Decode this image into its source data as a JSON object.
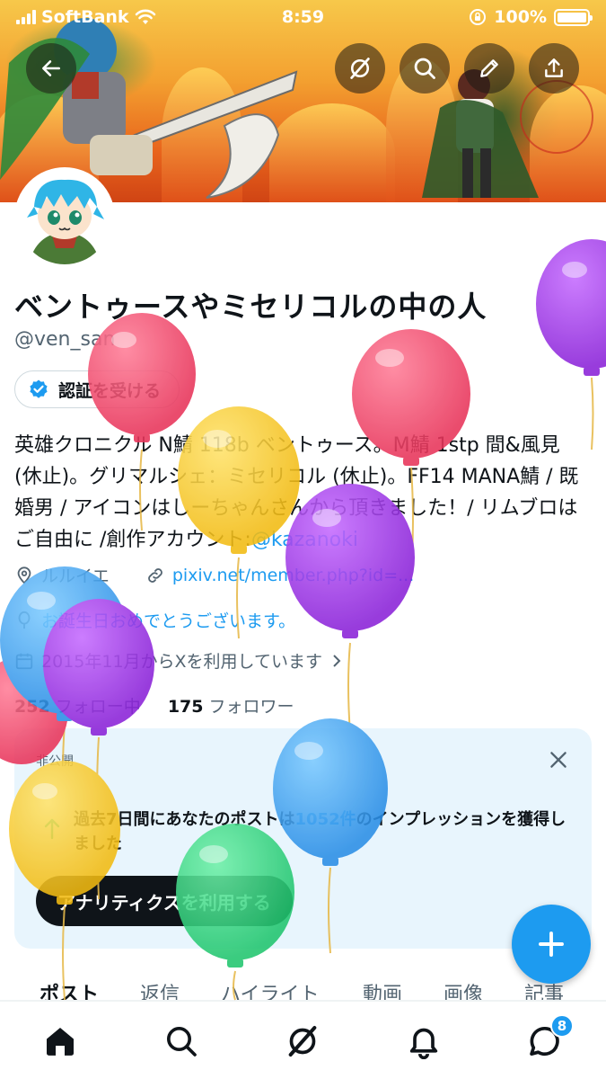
{
  "status_bar": {
    "carrier": "SoftBank",
    "time": "8:59",
    "battery": "100%"
  },
  "header": {
    "back_icon": "arrow-left-icon",
    "grok_icon": "grok-icon",
    "search_icon": "search-icon",
    "edit_icon": "pencil-icon",
    "share_icon": "share-icon"
  },
  "profile": {
    "display_name": "ベントゥースやミセリコルの中の人",
    "handle": "@ven_san",
    "verify_button": "認証を受ける",
    "bio_text": "英雄クロニクル N鯖 118b ベントゥース。M鯖 1stp 間&風見 (休止)。グリマルシェ：ミセリコル (休止)。FF14 MANA鯖 / 既婚男 / アイコンはしーちゃんさんから頂きました！/ リムブロはご自由に /創作アカウント:",
    "bio_link": "@kazanoki",
    "location": "ルルイエ",
    "website": "pixiv.net/member.php?id=...",
    "birthday": "お誕生日おめでとうございます。",
    "joined": "2015年11月からXを利用しています",
    "following_count": "252",
    "following_label": "フォロー中",
    "followers_count": "175",
    "followers_label": "フォロワー"
  },
  "analytics_card": {
    "private_label": "非公開",
    "message_before": "過去7日間にあなたのポストは",
    "message_number": "1052件",
    "message_after": "のインプレッションを獲得しました",
    "cta": "アナリティクスを利用する"
  },
  "tabs": [
    "ポスト",
    "返信",
    "ハイライト",
    "動画",
    "画像",
    "記事"
  ],
  "bottom_nav": {
    "items": [
      "home-icon",
      "search-icon",
      "grok-icon",
      "bell-icon",
      "messages-icon"
    ],
    "messages_badge": "8"
  },
  "colors": {
    "accent": "#1d9bf0",
    "text": "#0f1419",
    "secondary": "#536471",
    "card_bg": "#e8f5fd"
  }
}
